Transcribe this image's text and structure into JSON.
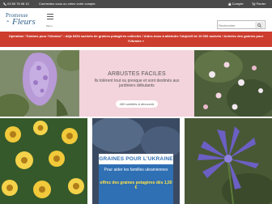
{
  "topbar": {
    "phone": "03 65 76 08 10",
    "connect": "Connectez-vous ou créez votre compte",
    "account": "Compte",
    "basket": "Panier"
  },
  "header": {
    "logo_line1": "Promesse",
    "logo_line2": "de",
    "logo_line3": "Fleurs",
    "menu_label": "Menu",
    "search_placeholder": "Rechercher"
  },
  "banner": {
    "text": "Opération \"Graines pour l'Ukraine\" : déjà 8454 sachets de graines potagères collectés ! Aidez-nous à atteindre l'objectif de 10 000 sachets ! Achetez des graines pour l'Ukraine »"
  },
  "hero": {
    "title": "ARBUSTES FACILES",
    "text": "Ils tolèrent tout ou presque et sont destinés aux jardiniers débutants",
    "button": "450 variétés à découvrir"
  },
  "promo": {
    "title": "GRAINES POUR L'UKRAINE",
    "text": "Pour aider les familles ukrainiennes",
    "offer": "offrez des graines potagères dès 1,50 €"
  },
  "colors": {
    "topbar": "#4a4a4a",
    "banner": "#cc3d2e",
    "hero_mid": "#f3d3dc",
    "brand_blue": "#2f6fb3",
    "offer_yellow": "#ffe34a"
  },
  "icons": [
    "phone-icon",
    "lock-icon",
    "cart-icon",
    "menu-icon",
    "search-icon"
  ]
}
